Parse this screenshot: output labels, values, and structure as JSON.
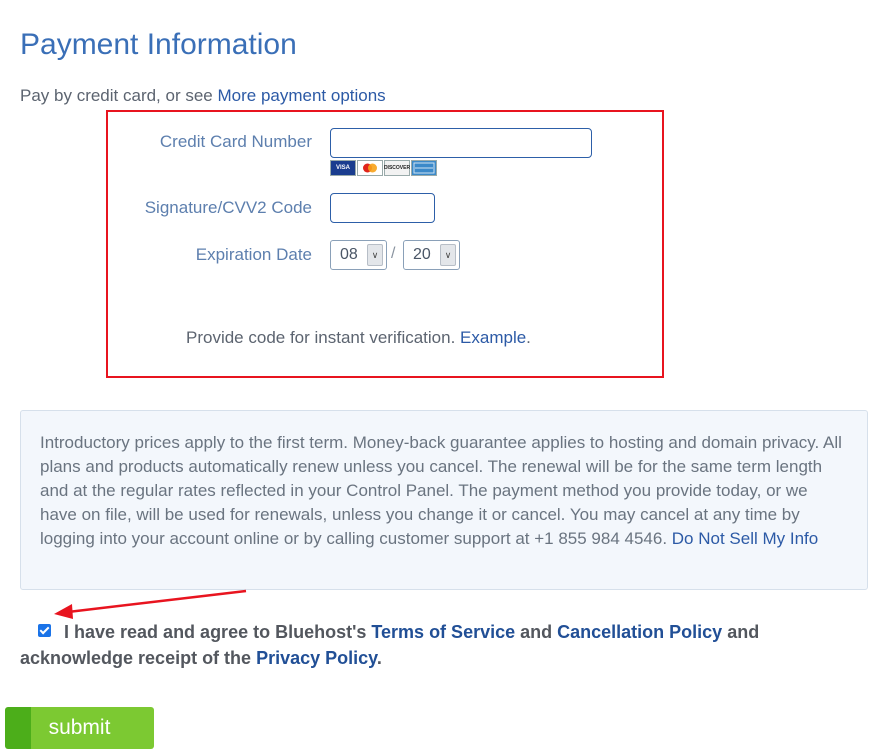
{
  "page": {
    "title": "Payment Information",
    "subtitle_prefix": "Pay by credit card, or see ",
    "more_options_link": "More payment options"
  },
  "form": {
    "card_number_label": "Credit Card Number",
    "card_number_value": "",
    "card_brands": [
      "VISA",
      "MasterCard",
      "DISCOVER",
      "AMEX"
    ],
    "cvv_label": "Signature/CVV2 Code",
    "cvv_value": "",
    "expiration_label": "Expiration Date",
    "expiration_month": "08",
    "expiration_separator": "/",
    "expiration_year": "20",
    "verify_text": "Provide code for instant verification. ",
    "verify_link": "Example",
    "verify_period": "."
  },
  "notice": {
    "text": "Introductory prices apply to the first term. Money-back guarantee applies to hosting and domain privacy. All plans and products automatically renew unless you cancel. The renewal will be for the same term length and at the regular rates reflected in your Control Panel. The payment method you provide today, or we have on file, will be used for renewals, unless you change it or cancel. You may cancel at any time by logging into your account online or by calling customer support at +1 855 984 4546. ",
    "link": "Do Not Sell My Info"
  },
  "agreement": {
    "checked": true,
    "text_1": "I have read and agree to Bluehost's ",
    "terms_link": "Terms of Service",
    "text_2": " and ",
    "cancellation_link": "Cancellation Policy",
    "text_3": " and acknowledge receipt of the ",
    "privacy_link": "Privacy Policy",
    "text_4": "."
  },
  "actions": {
    "submit_label": "submit"
  },
  "colors": {
    "heading": "#3a6fb7",
    "link": "#2c5aa6",
    "highlight_border": "#e8141f",
    "annotation_arrow": "#e8141f",
    "submit_button": "#7cc932"
  }
}
